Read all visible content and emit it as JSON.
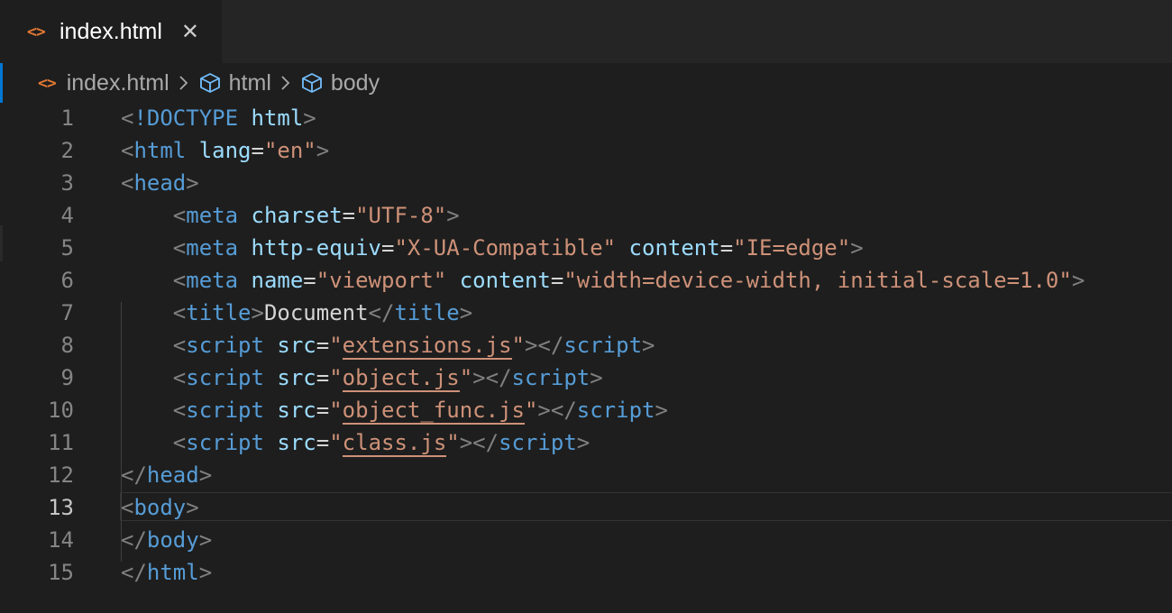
{
  "tab": {
    "label": "index.html",
    "icon": "html-file-icon",
    "close": "✕"
  },
  "breadcrumb": {
    "items": [
      "index.html",
      "html",
      "body"
    ]
  },
  "editor": {
    "current_line": 13,
    "line_numbers": [
      "1",
      "2",
      "3",
      "4",
      "5",
      "6",
      "7",
      "8",
      "9",
      "10",
      "11",
      "12",
      "13",
      "14",
      "15"
    ],
    "lines": [
      [
        [
          "p",
          "<"
        ],
        [
          "t",
          "!DOCTYPE"
        ],
        [
          "x",
          " "
        ],
        [
          "a",
          "html"
        ],
        [
          "p",
          ">"
        ]
      ],
      [
        [
          "p",
          "<"
        ],
        [
          "t",
          "html"
        ],
        [
          "x",
          " "
        ],
        [
          "a",
          "lang"
        ],
        [
          "x",
          "="
        ],
        [
          "s",
          "\"en\""
        ],
        [
          "p",
          ">"
        ]
      ],
      [
        [
          "p",
          "<"
        ],
        [
          "t",
          "head"
        ],
        [
          "p",
          ">"
        ]
      ],
      [
        [
          "x",
          "    "
        ],
        [
          "p",
          "<"
        ],
        [
          "t",
          "meta"
        ],
        [
          "x",
          " "
        ],
        [
          "a",
          "charset"
        ],
        [
          "x",
          "="
        ],
        [
          "s",
          "\"UTF-8\""
        ],
        [
          "p",
          ">"
        ]
      ],
      [
        [
          "x",
          "    "
        ],
        [
          "p",
          "<"
        ],
        [
          "t",
          "meta"
        ],
        [
          "x",
          " "
        ],
        [
          "a",
          "http-equiv"
        ],
        [
          "x",
          "="
        ],
        [
          "s",
          "\"X-UA-Compatible\""
        ],
        [
          "x",
          " "
        ],
        [
          "a",
          "content"
        ],
        [
          "x",
          "="
        ],
        [
          "s",
          "\"IE=edge\""
        ],
        [
          "p",
          ">"
        ]
      ],
      [
        [
          "x",
          "    "
        ],
        [
          "p",
          "<"
        ],
        [
          "t",
          "meta"
        ],
        [
          "x",
          " "
        ],
        [
          "a",
          "name"
        ],
        [
          "x",
          "="
        ],
        [
          "s",
          "\"viewport\""
        ],
        [
          "x",
          " "
        ],
        [
          "a",
          "content"
        ],
        [
          "x",
          "="
        ],
        [
          "s",
          "\"width=device-width, initial-scale=1.0\""
        ],
        [
          "p",
          ">"
        ]
      ],
      [
        [
          "x",
          "    "
        ],
        [
          "p",
          "<"
        ],
        [
          "t",
          "title"
        ],
        [
          "p",
          ">"
        ],
        [
          "x",
          "Document"
        ],
        [
          "p",
          "</"
        ],
        [
          "t",
          "title"
        ],
        [
          "p",
          ">"
        ]
      ],
      [
        [
          "x",
          "    "
        ],
        [
          "p",
          "<"
        ],
        [
          "t",
          "script"
        ],
        [
          "x",
          " "
        ],
        [
          "a",
          "src"
        ],
        [
          "x",
          "="
        ],
        [
          "s",
          "\""
        ],
        [
          "u",
          "extensions.js"
        ],
        [
          "s",
          "\""
        ],
        [
          "p",
          "></"
        ],
        [
          "t",
          "script"
        ],
        [
          "p",
          ">"
        ]
      ],
      [
        [
          "x",
          "    "
        ],
        [
          "p",
          "<"
        ],
        [
          "t",
          "script"
        ],
        [
          "x",
          " "
        ],
        [
          "a",
          "src"
        ],
        [
          "x",
          "="
        ],
        [
          "s",
          "\""
        ],
        [
          "u",
          "object.js"
        ],
        [
          "s",
          "\""
        ],
        [
          "p",
          "></"
        ],
        [
          "t",
          "script"
        ],
        [
          "p",
          ">"
        ]
      ],
      [
        [
          "x",
          "    "
        ],
        [
          "p",
          "<"
        ],
        [
          "t",
          "script"
        ],
        [
          "x",
          " "
        ],
        [
          "a",
          "src"
        ],
        [
          "x",
          "="
        ],
        [
          "s",
          "\""
        ],
        [
          "u",
          "object_func.js"
        ],
        [
          "s",
          "\""
        ],
        [
          "p",
          "></"
        ],
        [
          "t",
          "script"
        ],
        [
          "p",
          ">"
        ]
      ],
      [
        [
          "x",
          "    "
        ],
        [
          "p",
          "<"
        ],
        [
          "t",
          "script"
        ],
        [
          "x",
          " "
        ],
        [
          "a",
          "src"
        ],
        [
          "x",
          "="
        ],
        [
          "s",
          "\""
        ],
        [
          "u",
          "class.js"
        ],
        [
          "s",
          "\""
        ],
        [
          "p",
          "></"
        ],
        [
          "t",
          "script"
        ],
        [
          "p",
          ">"
        ]
      ],
      [
        [
          "p",
          "</"
        ],
        [
          "t",
          "head"
        ],
        [
          "p",
          ">"
        ]
      ],
      [
        [
          "p",
          "<"
        ],
        [
          "t",
          "body"
        ],
        [
          "p",
          ">"
        ]
      ],
      [
        [
          "p",
          "</"
        ],
        [
          "t",
          "body"
        ],
        [
          "p",
          ">"
        ]
      ],
      [
        [
          "p",
          "</"
        ],
        [
          "t",
          "html"
        ],
        [
          "p",
          ">"
        ]
      ]
    ]
  }
}
